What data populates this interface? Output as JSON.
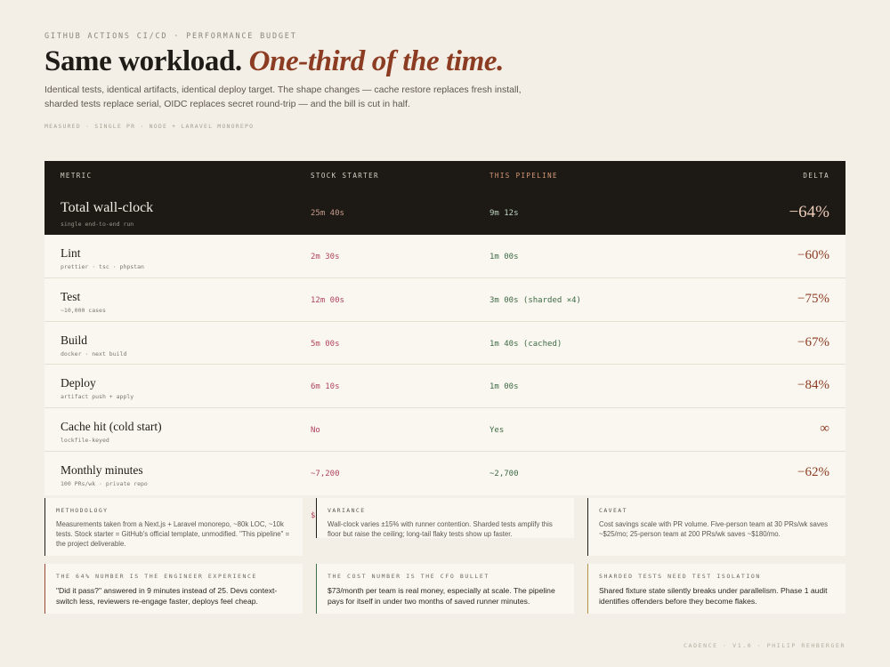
{
  "header": {
    "eyebrow": "GITHUB ACTIONS CI/CD · PERFORMANCE BUDGET",
    "title_main": "Same workload. ",
    "title_accent": "One-third of the time.",
    "subtitle": "Identical tests, identical artifacts, identical deploy target. The shape changes — cache restore replaces fresh install, sharded tests replace serial, OIDC replaces secret round-trip — and the bill is cut in half.",
    "measured": "MEASURED · SINGLE PR · NODE + LARAVEL MONOREPO"
  },
  "table": {
    "headers": {
      "metric": "METRIC",
      "stock": "STOCK STARTER",
      "pipeline": "THIS PIPELINE",
      "delta": "DELTA"
    },
    "total": {
      "name": "Total wall-clock",
      "sub": "single end-to-end run",
      "stock": "25m 40s",
      "pipeline": "9m 12s",
      "delta": "−64%"
    },
    "rows": [
      {
        "name": "Lint",
        "sub": "prettier · tsc · phpstan",
        "stock": "2m 30s",
        "pipeline": "1m 00s",
        "delta": "−60%"
      },
      {
        "name": "Test",
        "sub": "~10,000 cases",
        "stock": "12m 00s",
        "pipeline": "3m 00s (sharded ×4)",
        "delta": "−75%"
      },
      {
        "name": "Build",
        "sub": "docker · next build",
        "stock": "5m 00s",
        "pipeline": "1m 40s (cached)",
        "delta": "−67%"
      },
      {
        "name": "Deploy",
        "sub": "artifact push + apply",
        "stock": "6m 10s",
        "pipeline": "1m 00s",
        "delta": "−84%"
      },
      {
        "name": "Cache hit (cold start)",
        "sub": "lockfile-keyed",
        "stock": "No",
        "pipeline": "Yes",
        "delta": "∞"
      },
      {
        "name": "Monthly minutes",
        "sub": "100 PRs/wk · private repo",
        "stock": "~7,200",
        "pipeline": "~2,700",
        "delta": "−62%"
      }
    ],
    "ghost_text": "$"
  },
  "notes": [
    {
      "label": "METHODOLOGY",
      "body": "Measurements taken from a Next.js + Laravel monorepo, ~80k LOC, ~10k tests. Stock starter = GitHub's official template, unmodified. \"This pipeline\" = the project deliverable."
    },
    {
      "label": "VARIANCE",
      "body": "Wall-clock varies ±15% with runner contention. Sharded tests amplify this floor but raise the ceiling; long-tail flaky tests show up faster."
    },
    {
      "label": "CAVEAT",
      "body": "Cost savings scale with PR volume. Five-person team at 30 PRs/wk saves ~$25/mo; 25-person team at 200 PRs/wk saves ~$180/mo."
    }
  ],
  "callouts": [
    {
      "label": "THE 64% NUMBER IS THE ENGINEER EXPERIENCE",
      "body": "\"Did it pass?\" answered in 9 minutes instead of 25. Devs context-switch less, reviewers re-engage faster, deploys feel cheap."
    },
    {
      "label": "THE COST NUMBER IS THE CFO BULLET",
      "body": "$73/month per team is real money, especially at scale. The pipeline pays for itself in under two months of saved runner minutes."
    },
    {
      "label": "SHARDED TESTS NEED TEST ISOLATION",
      "body": "Shared fixture state silently breaks under parallelism. Phase 1 audit identifies offenders before they become flakes."
    }
  ],
  "footer": "CADENCE · V1.0 · PHILIP REHBERGER",
  "colors": {
    "accent": "#8c3c22",
    "stock": "#b0445a",
    "pipeline": "#3d6a44",
    "dark": "#1d1a16"
  }
}
